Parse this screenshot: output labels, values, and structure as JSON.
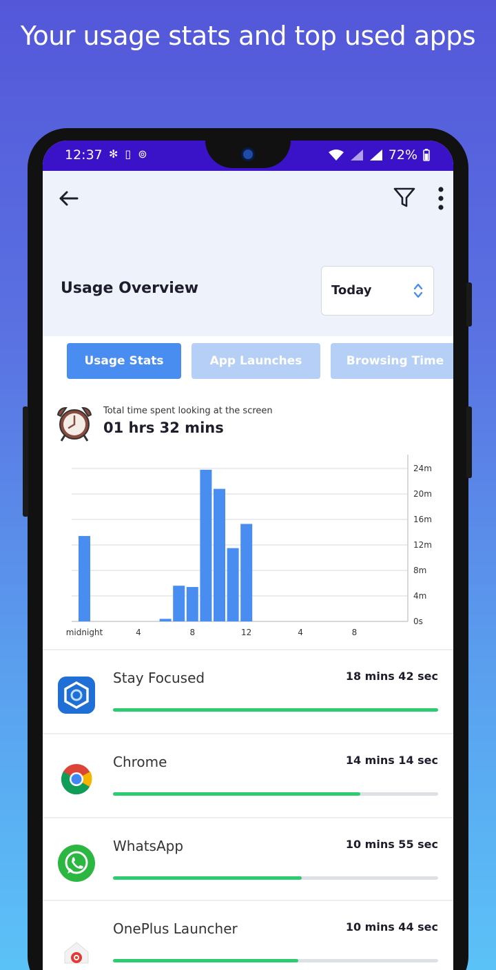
{
  "promo": {
    "title": "Your usage stats and top used apps"
  },
  "status_bar": {
    "time": "12:37",
    "battery": "72%",
    "left_icons": [
      "slack-icon",
      "sim-icon",
      "focus-app-icon"
    ],
    "right_icons": [
      "wifi-icon",
      "signal-icon",
      "signal-icon",
      "battery-icon"
    ]
  },
  "header": {
    "title": "Usage Overview",
    "period": "Today",
    "icons": [
      "back-arrow-icon",
      "filter-icon",
      "more-vertical-icon"
    ]
  },
  "tabs": [
    {
      "label": "Usage Stats",
      "active": true
    },
    {
      "label": "App Launches",
      "active": false
    },
    {
      "label": "Browsing Time",
      "active": false
    }
  ],
  "summary": {
    "label": "Total time spent looking at the screen",
    "value": "01 hrs 32 mins"
  },
  "chart_data": {
    "type": "bar",
    "x": [
      "0",
      "1",
      "2",
      "3",
      "4",
      "5",
      "6",
      "7",
      "8",
      "9",
      "10",
      "11",
      "12",
      "13",
      "14",
      "15",
      "16",
      "17",
      "18",
      "19",
      "20",
      "21",
      "22",
      "23"
    ],
    "values": [
      13.4,
      0,
      0,
      0,
      0,
      0,
      0.4,
      5.6,
      5.4,
      23.8,
      20.8,
      11.5,
      15.3,
      0,
      0,
      0,
      0,
      0,
      0,
      0,
      0,
      0,
      0,
      0
    ],
    "x_tick_labels": [
      "midnight",
      "4",
      "8",
      "12",
      "4",
      "8"
    ],
    "y_tick_labels": [
      "0s",
      "4m",
      "8m",
      "12m",
      "16m",
      "20m",
      "24m"
    ],
    "ylim": [
      0,
      24
    ],
    "y_unit": "minutes",
    "y_axis_position": "right",
    "grid": true,
    "bar_color": "#4a8df0"
  },
  "apps": [
    {
      "name": "Stay Focused",
      "time": "18 mins 42 sec",
      "progress": 1.0,
      "icon": "stay-focused-icon"
    },
    {
      "name": "Chrome",
      "time": "14 mins 14 sec",
      "progress": 0.76,
      "icon": "chrome-icon"
    },
    {
      "name": "WhatsApp",
      "time": "10 mins 55 sec",
      "progress": 0.58,
      "icon": "whatsapp-icon"
    },
    {
      "name": "OnePlus Launcher",
      "time": "10 mins 44 sec",
      "progress": 0.57,
      "icon": "oneplus-launcher-icon"
    }
  ],
  "colors": {
    "accent": "#4a8df0",
    "tab_inactive": "#b5cff6",
    "progress": "#2ecc71",
    "status_bar": "#3a12c8"
  }
}
